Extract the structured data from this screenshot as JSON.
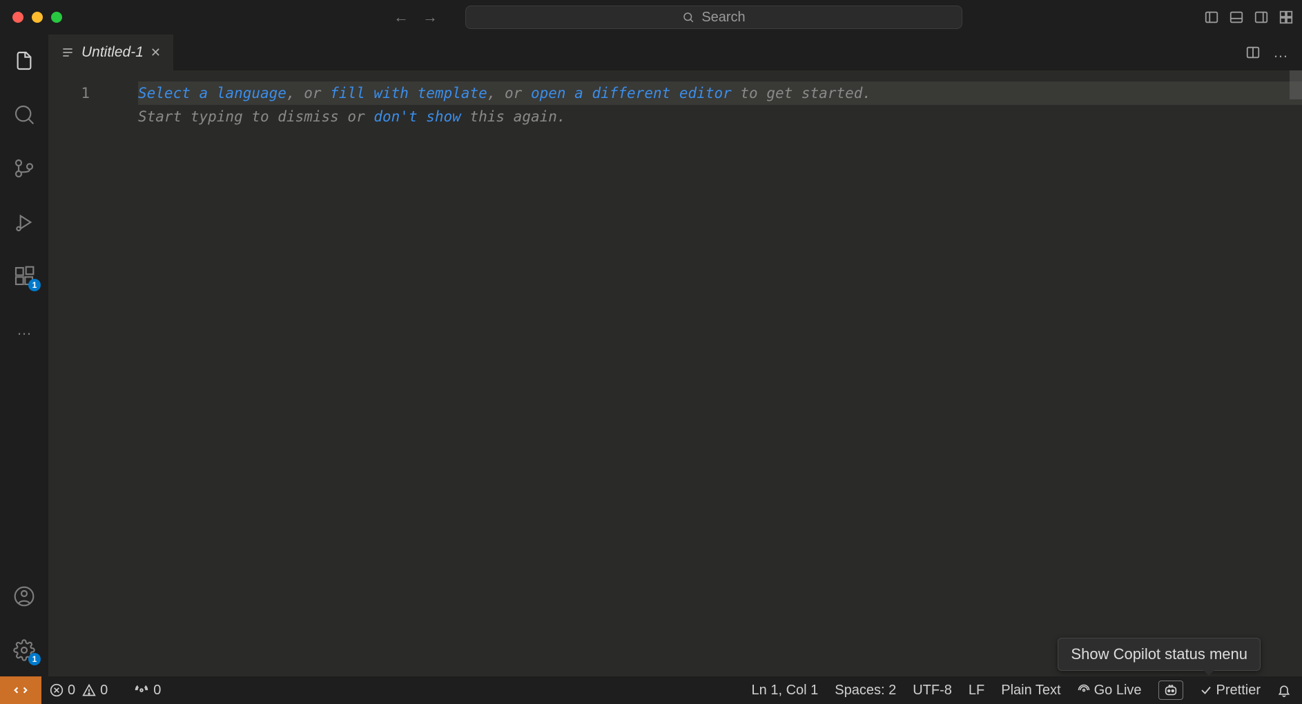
{
  "titlebar": {
    "search_placeholder": "Search"
  },
  "tabs": [
    {
      "label": "Untitled-1"
    }
  ],
  "editor": {
    "line_numbers": [
      "1"
    ],
    "line1": {
      "select_language": "Select a language",
      "sep1": ", or ",
      "fill_template": "fill with template",
      "sep2": ", or ",
      "open_editor": "open a different editor",
      "tail": " to get started."
    },
    "line2": {
      "prefix": "Start typing to dismiss or ",
      "dont_show": "don't show",
      "suffix": " this again."
    }
  },
  "activity": {
    "extensions_badge": "1",
    "settings_badge": "1"
  },
  "tooltip": "Show Copilot status menu",
  "status": {
    "errors": "0",
    "warnings": "0",
    "ports": "0",
    "cursor": "Ln 1, Col 1",
    "spaces": "Spaces: 2",
    "encoding": "UTF-8",
    "eol": "LF",
    "language": "Plain Text",
    "golive": "Go Live",
    "prettier": "Prettier"
  }
}
